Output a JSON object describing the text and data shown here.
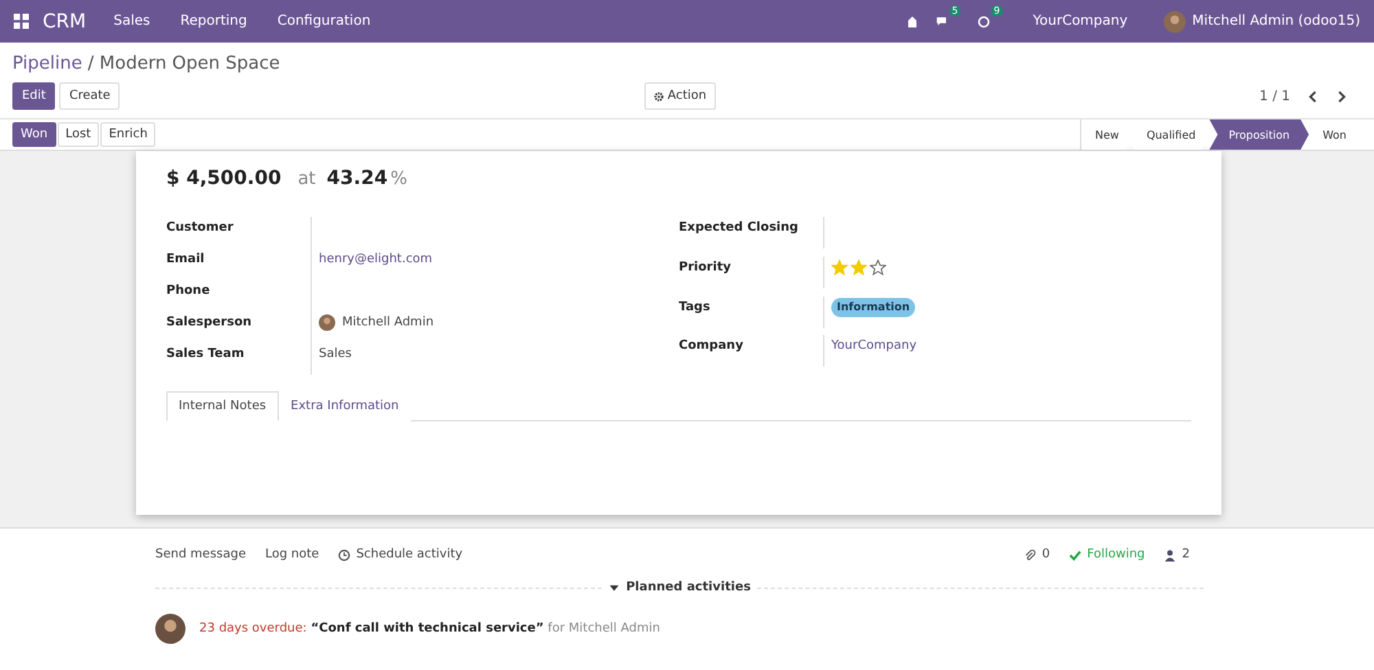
{
  "navbar": {
    "app": "CRM",
    "menu": [
      "Sales",
      "Reporting",
      "Configuration"
    ],
    "messages_badge": "5",
    "activities_badge": "9",
    "company": "YourCompany",
    "user": "Mitchell Admin (odoo15)"
  },
  "breadcrumb": {
    "parent": "Pipeline",
    "separator": "/",
    "current": "Modern Open Space"
  },
  "buttons": {
    "edit": "Edit",
    "create": "Create",
    "action": "Action"
  },
  "pager": "1 / 1",
  "header_buttons": [
    {
      "label": "Won",
      "primary": true
    },
    {
      "label": "Lost",
      "primary": false
    },
    {
      "label": "Enrich",
      "primary": false
    }
  ],
  "stages": [
    {
      "label": "New",
      "selected": false
    },
    {
      "label": "Qualified",
      "selected": false
    },
    {
      "label": "Proposition",
      "selected": true
    },
    {
      "label": "Won",
      "selected": false
    }
  ],
  "revenue": {
    "amount": "$ 4,500.00",
    "at": "at",
    "probability": "43.24",
    "unit": "%"
  },
  "left_fields": [
    {
      "label": "Customer",
      "kind": "text"
    },
    {
      "label": "Email",
      "kind": "link",
      "value": "henry@elight.com"
    },
    {
      "label": "Phone",
      "kind": "text"
    },
    {
      "label": "Salesperson",
      "kind": "user",
      "value": "Mitchell Admin"
    },
    {
      "label": "Sales Team",
      "kind": "text",
      "value": "Sales"
    }
  ],
  "right_fields": [
    {
      "label": "Expected Closing",
      "kind": "text"
    },
    {
      "label": "Priority",
      "kind": "stars",
      "stars": 2
    },
    {
      "label": "Tags",
      "kind": "tag",
      "value": "Information",
      "color": "#7dc3e8"
    },
    {
      "label": "Company",
      "kind": "link",
      "value": "YourCompany"
    }
  ],
  "notebook_tabs": [
    {
      "label": "Internal Notes",
      "selected": true
    },
    {
      "label": "Extra Information",
      "selected": false
    }
  ],
  "chatter": {
    "send": "Send message",
    "log": "Log note",
    "schedule": "Schedule activity",
    "attachments": "0",
    "following": "Following",
    "followers": "2",
    "planned": "Planned activities",
    "activity": {
      "overdue": "23 days overdue:",
      "summary": "“Conf call with technical service”",
      "assignee": "for Mitchell Admin"
    }
  }
}
